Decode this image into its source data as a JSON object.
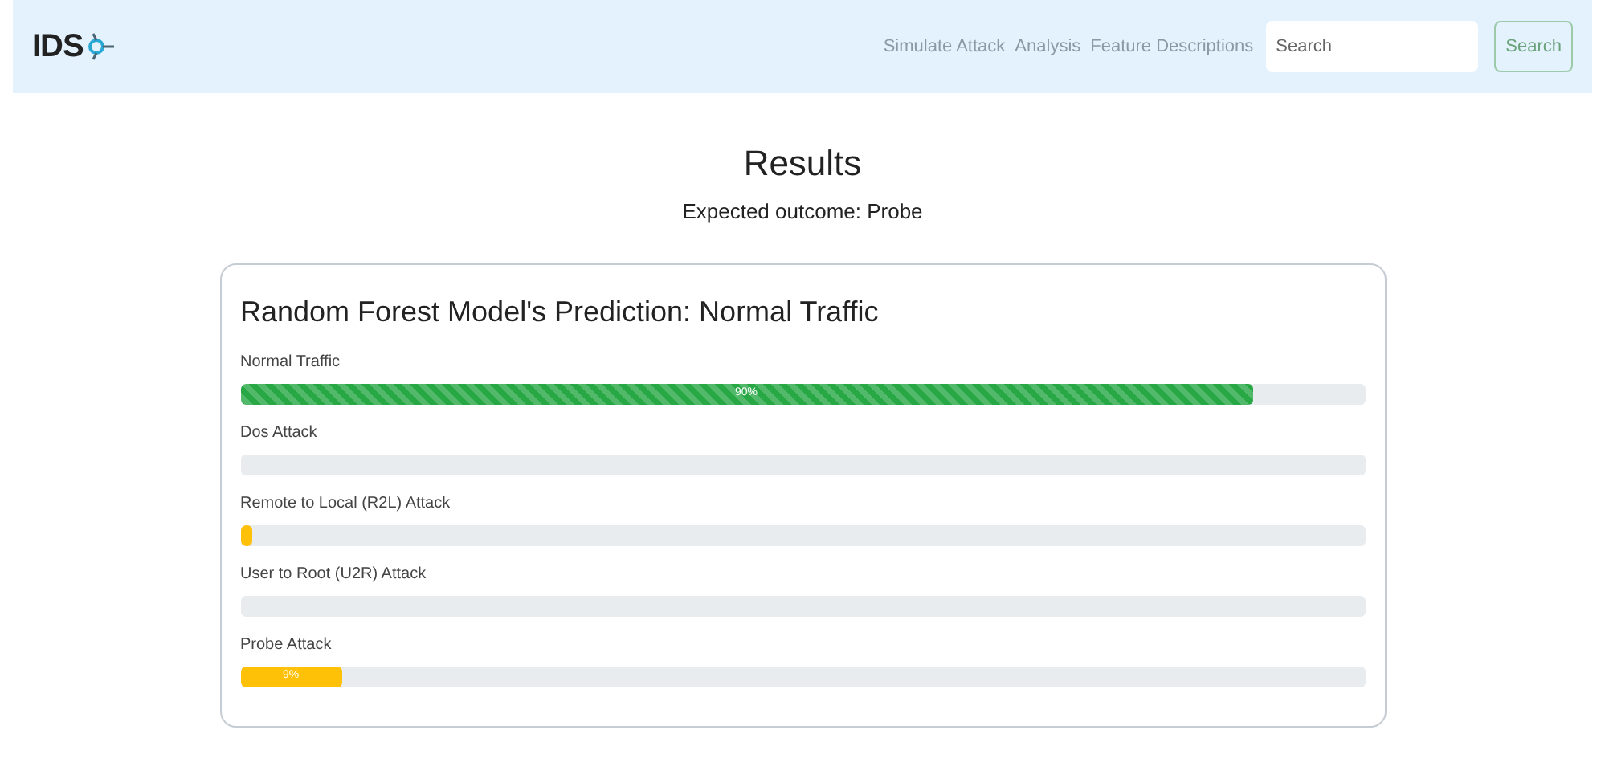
{
  "navbar": {
    "brand": "IDS",
    "links": [
      "Simulate Attack",
      "Analysis",
      "Feature Descriptions"
    ],
    "search": {
      "placeholder": "Search"
    },
    "search_button": "Search"
  },
  "heading": "Results",
  "subheading": "Expected outcome: Probe",
  "card": {
    "title": "Random Forest Model's Prediction: Normal Traffic",
    "bars": [
      {
        "label": "Normal Traffic",
        "level": 0.9,
        "reading": "90%",
        "color": "#28a745",
        "striped": true
      },
      {
        "label": "Dos Attack"
      },
      {
        "label": "Remote to Local (R2L) Attack",
        "level": 0.01,
        "color": "#ffc107",
        "striped": false
      },
      {
        "label": "User to Root (U2R) Attack"
      },
      {
        "label": "Probe Attack",
        "level": 0.09,
        "reading": "9%",
        "color": "#ffc107",
        "striped": false
      }
    ]
  }
}
